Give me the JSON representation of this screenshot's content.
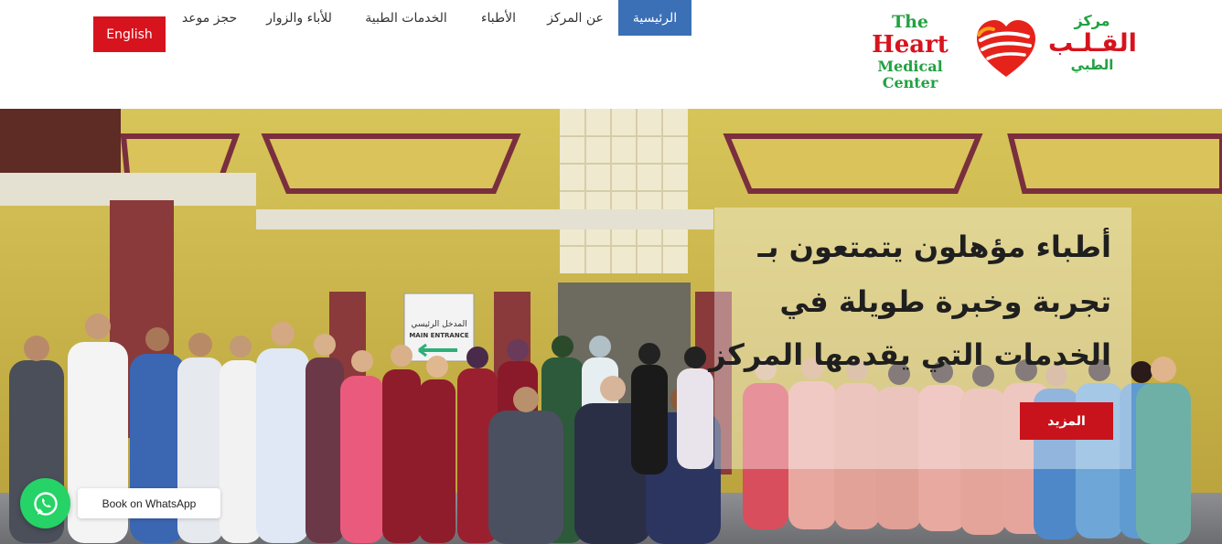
{
  "header": {
    "english_button": "English",
    "nav": [
      {
        "label": "الرئيسية",
        "active": true
      },
      {
        "label": "عن المركز",
        "active": false
      },
      {
        "label": "الأطباء",
        "active": false
      },
      {
        "label": "الخدمات الطبية",
        "active": false
      },
      {
        "label": "للأباء والزوار",
        "active": false
      },
      {
        "label": "حجز موعد",
        "active": false
      }
    ],
    "logo": {
      "en_line1": "The",
      "en_line2": "Heart",
      "en_line3": "Medical Center",
      "ar_line1": "مركز",
      "ar_line2": "القـلـب",
      "ar_line3": "الطبي"
    }
  },
  "hero": {
    "caption_lines": [
      "أطباء مؤهلون يتمتعون بـ",
      "تجربة وخبرة طويلة في",
      "الخدمات التي يقدمها المركز"
    ],
    "more_button": "المزيد",
    "sign_ar": "المدخل الرئيسي",
    "sign_en": "MAIN ENTRANCE"
  },
  "whatsapp": {
    "label": "Book on WhatsApp"
  },
  "colors": {
    "brand_red": "#d7131d",
    "brand_green": "#22a142",
    "nav_active": "#3b6fb6",
    "whatsapp_green": "#25d366"
  }
}
